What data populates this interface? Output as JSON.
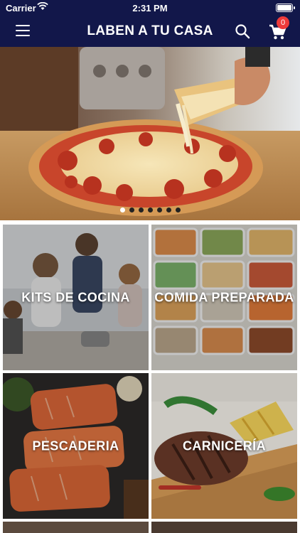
{
  "status_bar": {
    "carrier": "Carrier",
    "time": "2:31 PM"
  },
  "header": {
    "title": "LABEN A TU CASA",
    "cart_count": "0",
    "icons": {
      "menu": "hamburger-menu-icon",
      "search": "search-icon",
      "cart": "shopping-cart-icon"
    },
    "background": "#12174a",
    "badge_color": "#ee3a3a"
  },
  "hero": {
    "slide_count": 7,
    "active_slide": 1,
    "image": "pizza"
  },
  "categories": [
    {
      "label": "KITS DE COCINA"
    },
    {
      "label": "COMIDA PREPARADA"
    },
    {
      "label": "PESCADERIA"
    },
    {
      "label": "CARNICERÍA"
    }
  ]
}
